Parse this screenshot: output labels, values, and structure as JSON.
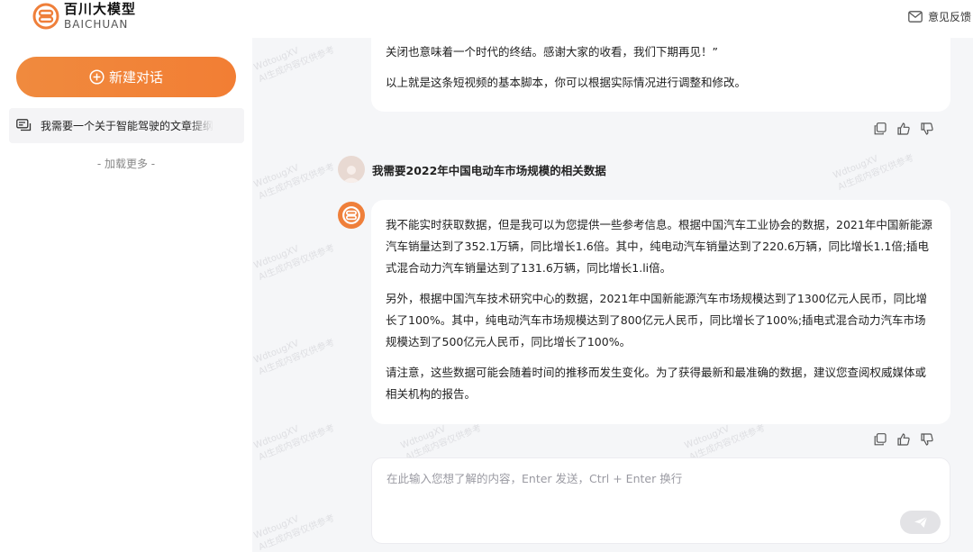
{
  "header": {
    "logo_cn": "百川大模型",
    "logo_en": "BAICHUAN",
    "feedback_label": "意见反馈"
  },
  "sidebar": {
    "new_chat_label": "新建对话",
    "history": [
      {
        "label": "我需要一个关于智能驾驶的文章提纲"
      }
    ],
    "load_more_label": "- 加载更多 -"
  },
  "watermark": {
    "line1": "WdtougXV",
    "line2": "AI生成内容仅供参考"
  },
  "messages": {
    "prev_bot": {
      "p1": "关闭也意味着一个时代的终结。感谢大家的收看，我们下期再见！”",
      "p2": "以上就是这条短视频的基本脚本，你可以根据实际情况进行调整和修改。"
    },
    "user": {
      "text": "我需要2022年中国电动车市场规模的相关数据"
    },
    "bot": {
      "p1": "我不能实时获取数据，但是我可以为您提供一些参考信息。根据中国汽车工业协会的数据，2021年中国新能源汽车销量达到了352.1万辆，同比增长1.6倍。其中，纯电动汽车销量达到了220.6万辆，同比增长1.1倍;插电式混合动力汽车销量达到了131.6万辆，同比增长1.li倍。",
      "p2": "另外，根据中国汽车技术研究中心的数据，2021年中国新能源汽车市场规模达到了1300亿元人民币，同比增长了100%。其中，纯电动汽车市场规模达到了800亿元人民币，同比增长了100%;插电式混合动力汽车市场规模达到了500亿元人民币，同比增长了100%。",
      "p3": "请注意，这些数据可能会随着时间的推移而发生变化。为了获得最新和最准确的数据，建议您查阅权威媒体或相关机构的报告。"
    }
  },
  "input": {
    "placeholder": "在此输入您想了解的内容，Enter 发送，Ctrl + Enter 换行",
    "value": ""
  },
  "icons": {
    "logo": "baichuan-logo-icon",
    "feedback": "mail-icon",
    "new_chat": "plus-circle-icon",
    "history": "chat-bubble-icon",
    "copy": "copy-icon",
    "like": "thumbs-up-icon",
    "dislike": "thumbs-down-icon",
    "send": "paper-plane-icon"
  },
  "colors": {
    "accent": "#f08a3e",
    "main_bg": "#f5f6f8",
    "bubble_bg": "#ffffff",
    "sidebar_item_bg": "#f4f4f6"
  }
}
